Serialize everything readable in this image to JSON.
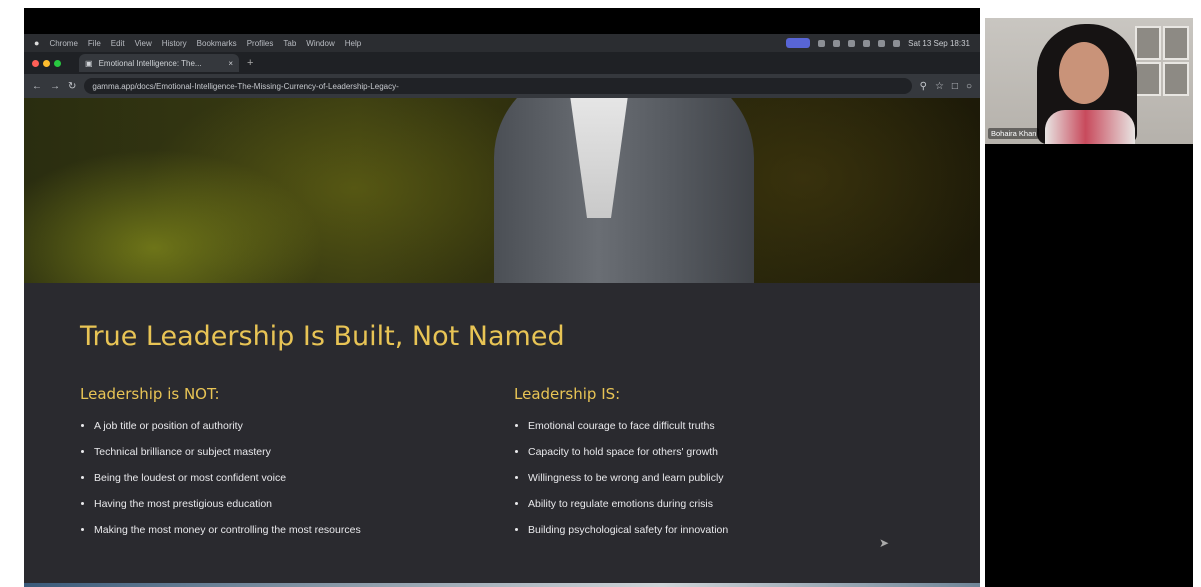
{
  "mac_menubar": {
    "apple": "",
    "items": [
      "Chrome",
      "File",
      "Edit",
      "View",
      "History",
      "Bookmarks",
      "Profiles",
      "Tab",
      "Window",
      "Help"
    ],
    "clock": "Sat 13 Sep 18:31"
  },
  "browser": {
    "tab_title": "Emotional Intelligence: The...",
    "new_tab": "+",
    "url": "gamma.app/docs/Emotional-Intelligence-The-Missing-Currency-of-Leadership-Legacy-",
    "nav_back": "←",
    "nav_forward": "→",
    "reload": "↻"
  },
  "slide": {
    "title": "True Leadership Is Built, Not Named",
    "left_heading": "Leadership is NOT:",
    "left_items": [
      "A job title or position of authority",
      "Technical brilliance or subject mastery",
      "Being the loudest or most confident voice",
      "Having the most prestigious education",
      "Making the most money or controlling the most resources"
    ],
    "right_heading": "Leadership IS:",
    "right_items": [
      "Emotional courage to face difficult truths",
      "Capacity to hold space for others' growth",
      "Willingness to be wrong and learn publicly",
      "Ability to regulate emotions during crisis",
      "Building psychological safety for innovation"
    ]
  },
  "video_call": {
    "participant_name": "Bohaira Khan"
  },
  "colors": {
    "accent_gold": "#e8c455",
    "slide_background": "#2a2a2f",
    "bullet_text": "#e9e9ec"
  }
}
